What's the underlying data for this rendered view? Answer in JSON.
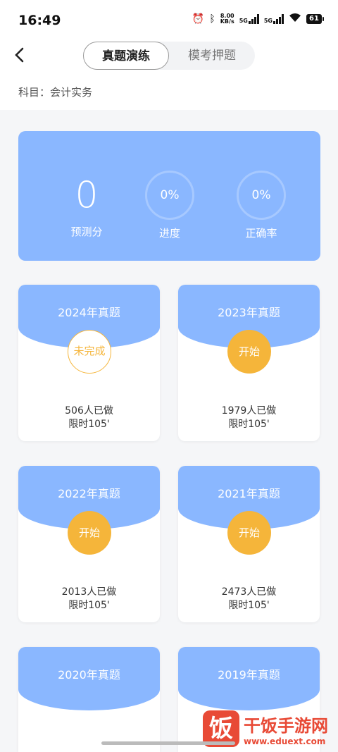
{
  "status": {
    "time": "16:49",
    "net_speed": "8.00",
    "net_unit": "KB/s",
    "sig1": "5G",
    "sig2": "5G",
    "battery": "61"
  },
  "header": {
    "tabs": [
      "真题演练",
      "模考押题"
    ],
    "active_tab": 0,
    "subject": "科目：会计实务"
  },
  "stats": {
    "score": "0",
    "score_label": "预测分",
    "progress": "0%",
    "progress_label": "进度",
    "accuracy": "0%",
    "accuracy_label": "正确率"
  },
  "papers": [
    {
      "title": "2024年真题",
      "badge": "未完成",
      "done": "506人已做",
      "limit": "限时105'"
    },
    {
      "title": "2023年真题",
      "badge": "开始",
      "done": "1979人已做",
      "limit": "限时105'"
    },
    {
      "title": "2022年真题",
      "badge": "开始",
      "done": "2013人已做",
      "limit": "限时105'"
    },
    {
      "title": "2021年真题",
      "badge": "开始",
      "done": "2473人已做",
      "limit": "限时105'"
    },
    {
      "title": "2020年真题"
    },
    {
      "title": "2019年真题"
    }
  ],
  "watermark": {
    "logo": "饭",
    "name": "干饭手游网",
    "url": "www.eduext.com"
  }
}
